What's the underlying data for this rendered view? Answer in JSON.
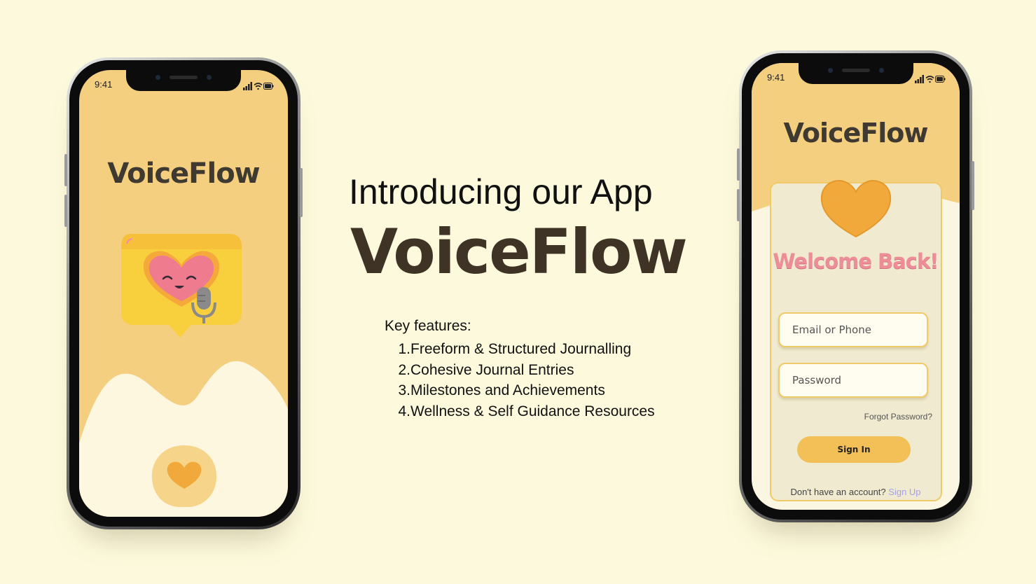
{
  "intro": {
    "heading": "Introducing our App",
    "app_name": "VoiceFlow",
    "features_heading": "Key features:",
    "features": [
      "Freeform & Structured Journalling",
      "Cohesive Journal Entries",
      "Milestones and Achievements",
      "Wellness & Self Guidance Resources"
    ]
  },
  "splash_screen": {
    "status_time": "9:41",
    "title": "VoiceFlow",
    "logo_icon": "heart-microphone-speech-bubble-icon",
    "bottom_icon": "heart-icon"
  },
  "login_screen": {
    "status_time": "9:41",
    "title": "VoiceFlow",
    "heart_icon": "heart-icon",
    "welcome": "Welcome Back!",
    "email_placeholder": "Email or Phone",
    "password_placeholder": "Password",
    "forgot_password": "Forgot Password?",
    "sign_in": "Sign In",
    "no_account_text": "Don't have an account?",
    "sign_up": "Sign Up"
  },
  "colors": {
    "background": "#fdf9dc",
    "brand_yellow": "#f5cf80",
    "accent_orange": "#f0a93a",
    "pink": "#ec8d98",
    "title_brown": "#3f3326",
    "link_lavender": "#a7a0e6"
  }
}
